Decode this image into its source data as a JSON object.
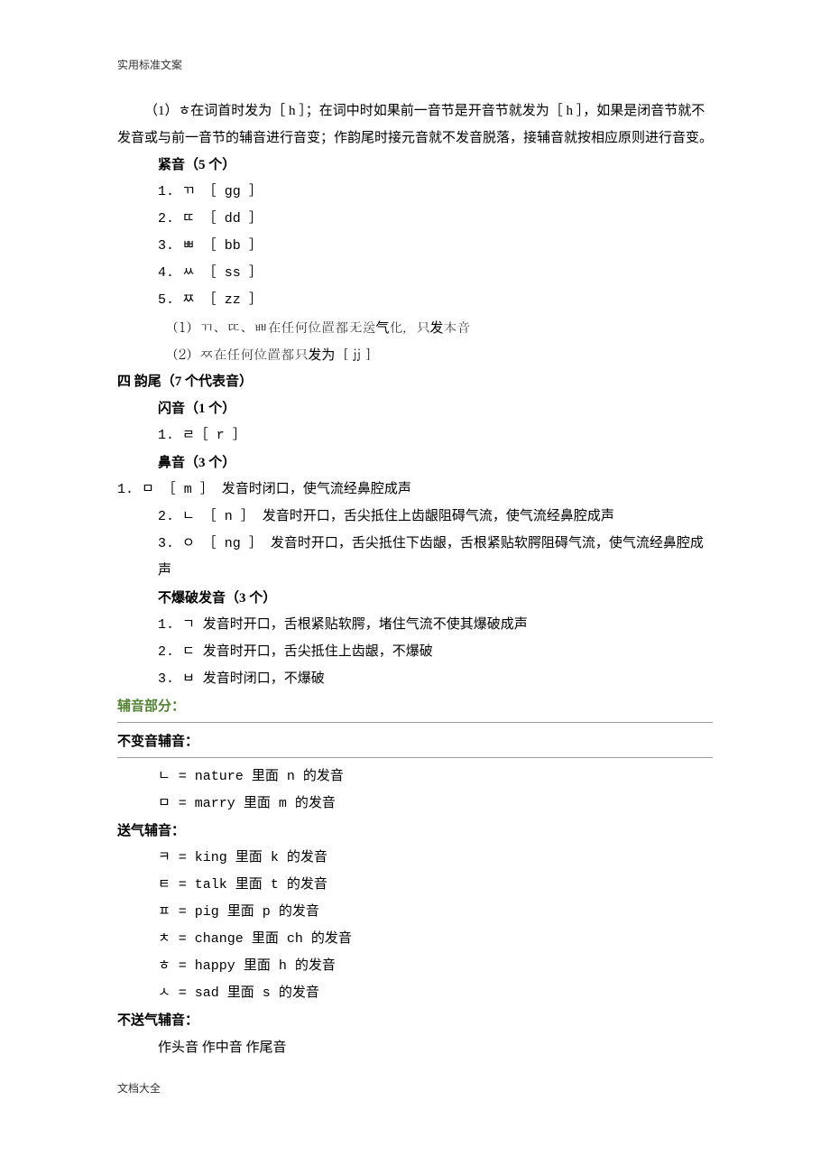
{
  "header": "实用标准文案",
  "intro": "（1）ㅎ在词首时发为［ h ］；在词中时如果前一音节是开音节就发为［ h ］，如果是闭音节就不发音或与前一音节的辅音进行音变；作韵尾时接元音就不发音脱落，接辅音就按相应原则进行音变。",
  "tense_title": "紧音（5 个）",
  "tense": [
    "1.  ㄲ ［ gg ］",
    "2.  ㄸ ［ dd ］",
    "3.  ㅃ ［ bb ］",
    "4.  ㅆ ［ ss ］",
    "5.  ㅉ ［ zz ］"
  ],
  "tense_notes": [
    "（1）ㄲ、ㄸ、ㅃ在任何位置都无送气化，只发本音",
    "（2）ㅉ在任何位置都只发为［ jj ］"
  ],
  "final_title": "四 韵尾（7 个代表音）",
  "flap_title": "闪音（1 个）",
  "flap": "1.  ㄹ［ r ］",
  "nasal_title": "鼻音（3 个）",
  "nasal": [
    "1.  ㅁ ［ m ］ 发音时闭口，使气流经鼻腔成声",
    "2.  ㄴ ［ n ］ 发音时开口，舌尖抵住上齿龈阻碍气流，使气流经鼻腔成声",
    "3.  ㅇ ［ ng ］ 发音时开口，舌尖抵住下齿龈，舌根紧贴软腭阻碍气流，使气流经鼻腔成声"
  ],
  "stop_title": "不爆破发音（3 个）",
  "stop": [
    "1.  ㄱ 发音时开口，舌根紧贴软腭，堵住气流不使其爆破成声",
    "2.  ㄷ 发音时开口，舌尖抵住上齿龈，不爆破",
    "3.  ㅂ 发音时闭口，不爆破"
  ],
  "green_section": "辅音部分：",
  "invariant_title": "不变音辅音：",
  "invariant": [
    "ㄴ = nature 里面 n 的发音",
    "ㅁ = marry 里面 m 的发音"
  ],
  "aspirated_title": "送气辅音：",
  "aspirated": [
    "ㅋ = king 里面 k 的发音",
    "ㅌ = talk 里面 t 的发音",
    "ㅍ = pig 里面 p 的发音",
    "ㅊ = change 里面 ch 的发音",
    "ㅎ = happy 里面 h 的发音",
    "ㅅ = sad 里面 s 的发音"
  ],
  "unaspirated_title": "不送气辅音：",
  "unaspirated_row": "作头音  作中音  作尾音",
  "footer": "文档大全"
}
